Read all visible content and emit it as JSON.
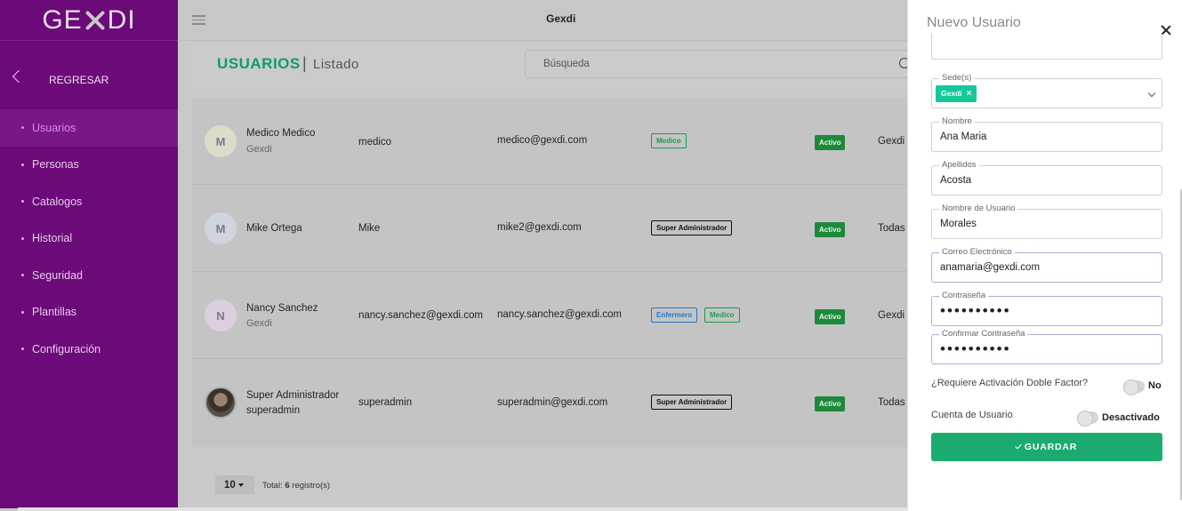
{
  "app": {
    "logo": "GEXDI",
    "top_title": "Gexdi"
  },
  "sidebar": {
    "back_label": "REGRESAR",
    "items": [
      {
        "label": "Usuarios",
        "active": true
      },
      {
        "label": "Personas"
      },
      {
        "label": "Catalogos"
      },
      {
        "label": "Historial"
      },
      {
        "label": "Seguridad"
      },
      {
        "label": "Plantillas"
      },
      {
        "label": "Configuración"
      }
    ]
  },
  "page": {
    "title": "USUARIOS",
    "subtitle": "Listado",
    "search_placeholder": "Búsqueda"
  },
  "users": [
    {
      "initial": "M",
      "name": "Medico Medico",
      "sub": "Gexdi",
      "username": "medico",
      "email": "medico@gexdi.com",
      "roles": [
        "Medico"
      ],
      "status": "Activo",
      "site": "Gexdi"
    },
    {
      "initial": "M",
      "name": "Mike Ortega",
      "sub": "",
      "username": "Mike",
      "email": "mike2@gexdi.com",
      "roles": [
        "Super Administrador"
      ],
      "status": "Activo",
      "site": "Todas"
    },
    {
      "initial": "N",
      "name": "Nancy Sanchez",
      "sub": "Gexdi",
      "username": "nancy.sanchez@gexdi.com",
      "email": "nancy.sanchez@gexdi.com",
      "roles": [
        "Enfermero",
        "Medico"
      ],
      "status": "Activo",
      "site": "Gexdi"
    },
    {
      "initial": "",
      "name": "Super Administrador",
      "sub": "superadmin",
      "username": "superadmin",
      "email": "superadmin@gexdi.com",
      "roles": [
        "Super Administrador"
      ],
      "status": "Activo",
      "site": "Todas"
    }
  ],
  "footer": {
    "page_size": "10",
    "total_prefix": "Total:",
    "total_count": "6",
    "total_suffix": "registro(s)"
  },
  "drawer": {
    "title": "Nuevo Usuario",
    "sede_label": "Sede(s)",
    "sede_chip": "Gexdi",
    "chip_remove": "×",
    "fields": {
      "nombre": {
        "label": "Nombre",
        "value": "Ana Maria"
      },
      "apellidos": {
        "label": "Apellidos",
        "value": "Acosta"
      },
      "usuario": {
        "label": "Nombre de Usuario",
        "value": "Morales"
      },
      "correo": {
        "label": "Correo Electrónico",
        "value": "anamaria@gexdi.com"
      },
      "contrasena": {
        "label": "Contraseña",
        "value": "••••••••••"
      },
      "confirmar": {
        "label": "Confirmar Contraseña",
        "value": "••••••••••"
      }
    },
    "two_factor_label": "¿Requiere Activación Doble Factor?",
    "two_factor_value": "No",
    "account_label": "Cuenta de Usuario",
    "account_value": "Desactivado",
    "save_label": "GUARDAR"
  },
  "colors": {
    "sidebar": "#6b0a78",
    "accent_green": "#1bab6f",
    "title_green": "#0e9e63",
    "status_green": "#1d8a3b"
  }
}
